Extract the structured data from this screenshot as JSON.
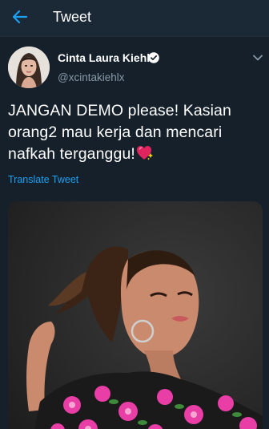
{
  "header": {
    "title": "Tweet"
  },
  "tweet": {
    "author_name": "Cinta Laura Kiehl",
    "author_handle": "@xcintakiehlx",
    "text_line_1": "JANGAN DEMO please! Kasian",
    "text_line_2": "orang2 mau kerja dan mencari",
    "text_line_3": "nafkah terganggu!",
    "translate_label": "Translate Tweet",
    "emoji": "sparkling-heart-icon"
  },
  "icons": {
    "back": "arrow-left-icon",
    "verified": "verified-badge-icon",
    "more": "chevron-down-icon"
  },
  "colors": {
    "background": "#15202b",
    "header": "#1b2836",
    "accent": "#1da1f2",
    "secondary_text": "#8899a6",
    "heart": "#e0245e"
  }
}
